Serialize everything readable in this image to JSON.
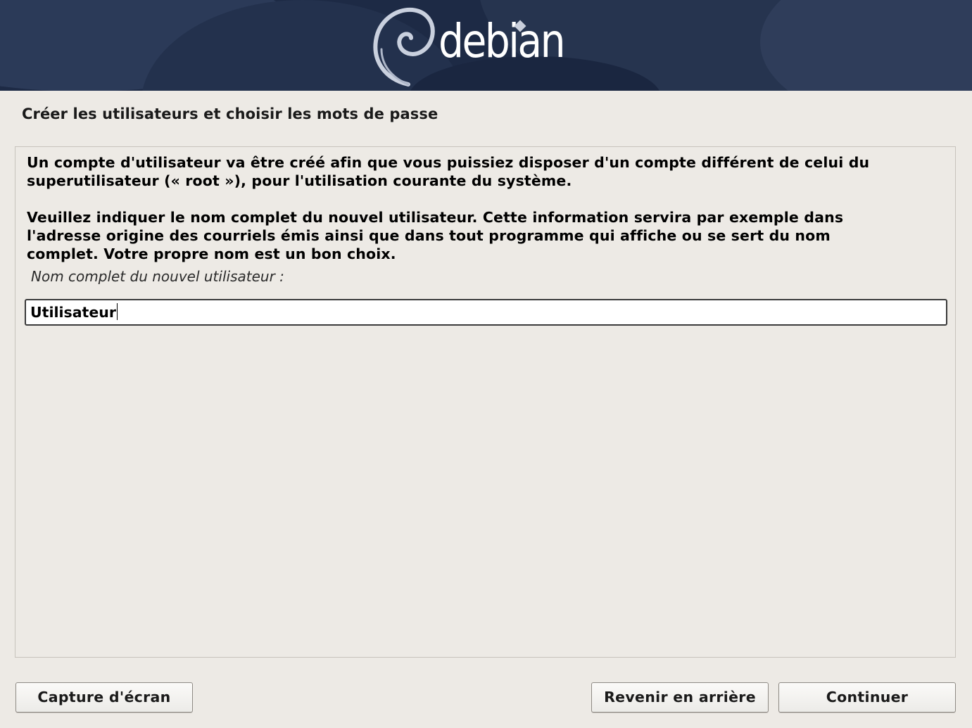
{
  "header": {
    "logo_text": "debian"
  },
  "page": {
    "title": "Créer les utilisateurs et choisir les mots de passe"
  },
  "main": {
    "paragraph_1_line_1": "Un compte d'utilisateur va être créé afin que vous puissiez disposer d'un compte différent de celui du",
    "paragraph_1_line_2": "superutilisateur (« root »), pour l'utilisation courante du système.",
    "paragraph_2_line_1": "Veuillez indiquer le nom complet du nouvel utilisateur. Cette information servira par exemple dans",
    "paragraph_2_line_2": "l'adresse origine des courriels émis ainsi que dans tout programme qui affiche ou se sert du nom",
    "paragraph_2_line_3": "complet. Votre propre nom est un bon choix.",
    "field_label": "Nom complet du nouvel utilisateur :",
    "field_value": "Utilisateur"
  },
  "buttons": {
    "screenshot_label": "Capture d'écran",
    "back_label": "Revenir en arrière",
    "continue_label": "Continuer"
  },
  "colors": {
    "banner": "#1d2a45",
    "background": "#edeae5"
  }
}
